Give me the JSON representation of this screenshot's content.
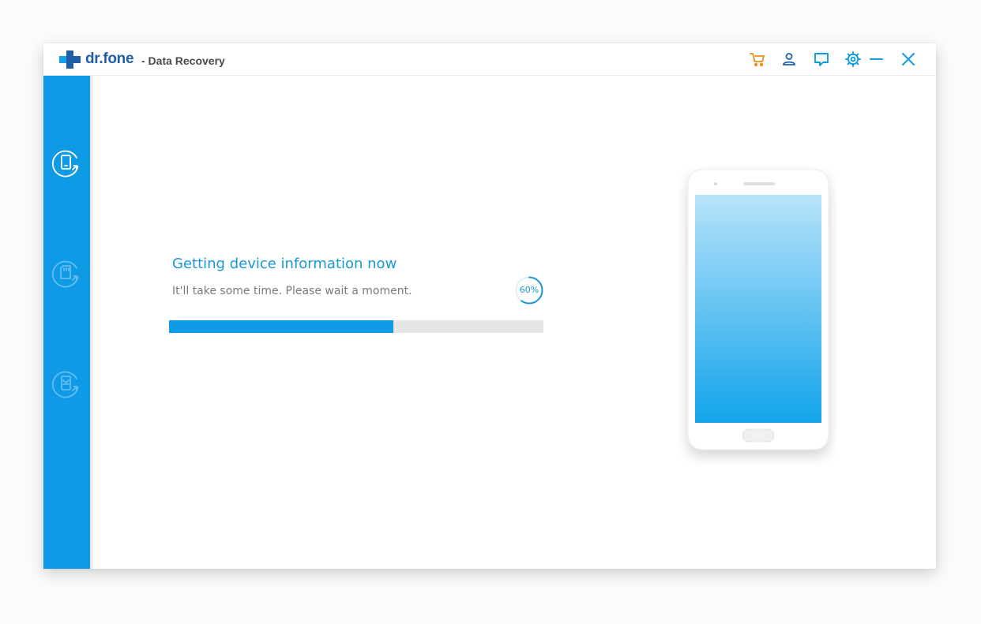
{
  "app": {
    "brand": "dr.fone",
    "subtitle": "- Data Recovery"
  },
  "toolbar": {
    "icons": [
      "cart-icon",
      "account-icon",
      "feedback-icon",
      "settings-icon",
      "minimize-icon",
      "close-icon"
    ]
  },
  "sidebar": {
    "items": [
      {
        "icon": "phone-recover-icon",
        "active": true
      },
      {
        "icon": "sd-card-recover-icon",
        "active": false
      },
      {
        "icon": "backup-recover-icon",
        "active": false
      }
    ]
  },
  "status": {
    "heading": "Getting device information now",
    "subtext": "It'll take some time. Please wait a moment.",
    "percent_label": "60%",
    "progress": 0.6
  },
  "colors": {
    "accent": "#0f9ae5",
    "cart": "#f08a1c",
    "brand": "#1f5fa8"
  }
}
